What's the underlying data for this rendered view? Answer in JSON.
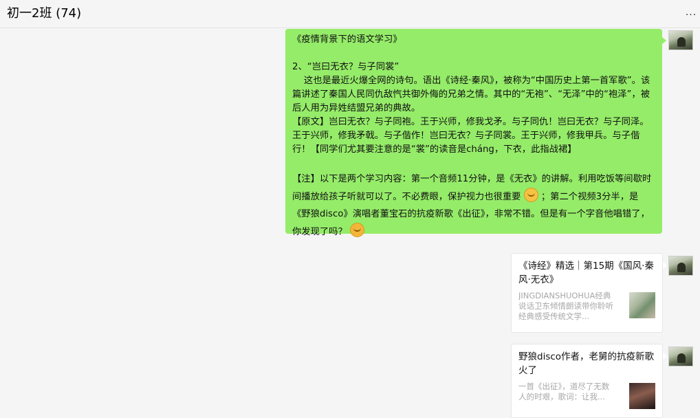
{
  "chat": {
    "title": "初一2班 (74)",
    "more_label": "..."
  },
  "message": {
    "heading": "《疫情背景下的语文学习》",
    "p1": "2、“岂曰无衣？与子同裳”\n    这也是最近火爆全网的诗句。语出《诗经·秦风》，被称为“中国历史上第一首军歌”。该篇讲述了秦国人民同仇敌忾共御外侮的兄弟之情。其中的“无袍”、“无泽”中的“袍泽”，被后人用为异姓结盟兄弟的典故。",
    "p2": "【原文】岂曰无衣？与子同袍。王于兴师，修我戈矛。与子同仇！岂曰无衣？与子同泽。王于兴师，修我矛戟。与子偕作！岂曰无衣？与子同裳。王于兴师，修我甲兵。与子偕行！【同学们尤其要注意的是“裳”的读音是cháng，下衣，此指战裙】",
    "p3a": "【注】以下是两个学习内容：第一个音频11分钟，是《无衣》的讲解。利用吃饭等间歇时间播放给孩子听就可以了。不必费眼，保护视力也很重要",
    "p3b": "；第二个视频3分半，是《野狼disco》演唱者董宝石的抗疫新歌《出征》，非常不错。但是有一个字音他唱错了，你发现了吗？",
    "emoji_1": "smile-emoji",
    "emoji_2": "thinking-emoji"
  },
  "cards": [
    {
      "title": "《诗经》精选｜第15期《国风·秦风·无衣》",
      "desc": "JINGDIANSHUOHUA经典说话卫东倾情朗读带你聆听经典感受传统文学..."
    },
    {
      "title": "野狼disco作者，老舅的抗疫新歌火了",
      "desc": "一首《出征》，道尽了无数人的时艰，歌词：让我..."
    }
  ],
  "colors": {
    "bubble": "#95ec69",
    "background": "#f5f5f5"
  }
}
